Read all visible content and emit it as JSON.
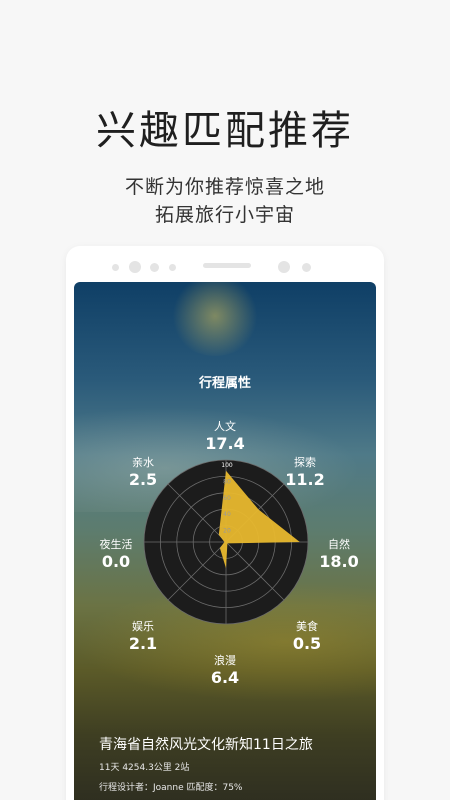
{
  "hero": {
    "title": "兴趣匹配推荐",
    "subtitle_line1": "不断为你推荐惊喜之地",
    "subtitle_line2": "拓展旅行小宇宙"
  },
  "card": {
    "section_title": "行程属性",
    "attributes": [
      {
        "label": "人文",
        "value": "17.4"
      },
      {
        "label": "探索",
        "value": "11.2"
      },
      {
        "label": "自然",
        "value": "18.0"
      },
      {
        "label": "美食",
        "value": "0.5"
      },
      {
        "label": "浪漫",
        "value": "6.4"
      },
      {
        "label": "娱乐",
        "value": "2.1"
      },
      {
        "label": "夜生活",
        "value": "0.0"
      },
      {
        "label": "亲水",
        "value": "2.5"
      }
    ],
    "radar_scale": [
      "100",
      "80",
      "60",
      "40",
      "20"
    ],
    "trip_title": "青海省自然风光文化新知11日之旅",
    "trip_meta1": "11天   4254.3公里   2站",
    "trip_meta2": "行程设计者：Joanne   匹配度：75%"
  },
  "chart_data": {
    "type": "radar",
    "axes": [
      "人文",
      "探索",
      "自然",
      "美食",
      "浪漫",
      "娱乐",
      "夜生活",
      "亲水"
    ],
    "values": [
      17.4,
      11.2,
      18.0,
      0.5,
      6.4,
      2.1,
      0.0,
      2.5
    ],
    "range": [
      0,
      20
    ],
    "tick_labels": [
      "100",
      "80",
      "60",
      "40",
      "20"
    ],
    "fill_color": "#e8b82e",
    "grid_color": "#6b6b6b",
    "background_color": "#1c1c1c"
  },
  "colors": {
    "accent": "#e8b82e"
  }
}
